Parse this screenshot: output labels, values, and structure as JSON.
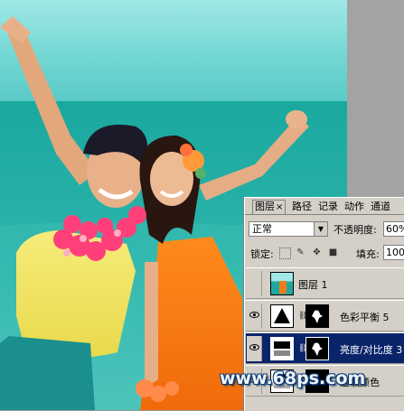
{
  "layers_panel": {
    "tabs": [
      {
        "label": "图层",
        "close": "×",
        "active": true
      },
      {
        "label": "路径",
        "active": false
      },
      {
        "label": "记录",
        "active": false
      },
      {
        "label": "动作",
        "active": false
      },
      {
        "label": "通道",
        "active": false
      }
    ],
    "blend_mode": "正常",
    "opacity_label": "不透明度:",
    "opacity_value": "60%",
    "lock_label": "锁定:",
    "fill_label": "填充:",
    "fill_value": "100%",
    "layers": [
      {
        "name": "图层 1",
        "visible": false,
        "selected": false,
        "type": "pixel"
      },
      {
        "name": "色彩平衡 5",
        "visible": true,
        "selected": false,
        "type": "adjustment"
      },
      {
        "name": "亮度/对比度 3",
        "visible": true,
        "selected": true,
        "type": "adjustment"
      },
      {
        "name": "选取颜色",
        "visible": true,
        "selected": false,
        "type": "adjustment"
      }
    ]
  },
  "watermark": "www.68ps.com",
  "colors": {
    "sky_top": "#6ad9d6",
    "sea": "#1fa8a0",
    "selection": "#0a246a",
    "panel_bg": "#d4d0c8"
  }
}
